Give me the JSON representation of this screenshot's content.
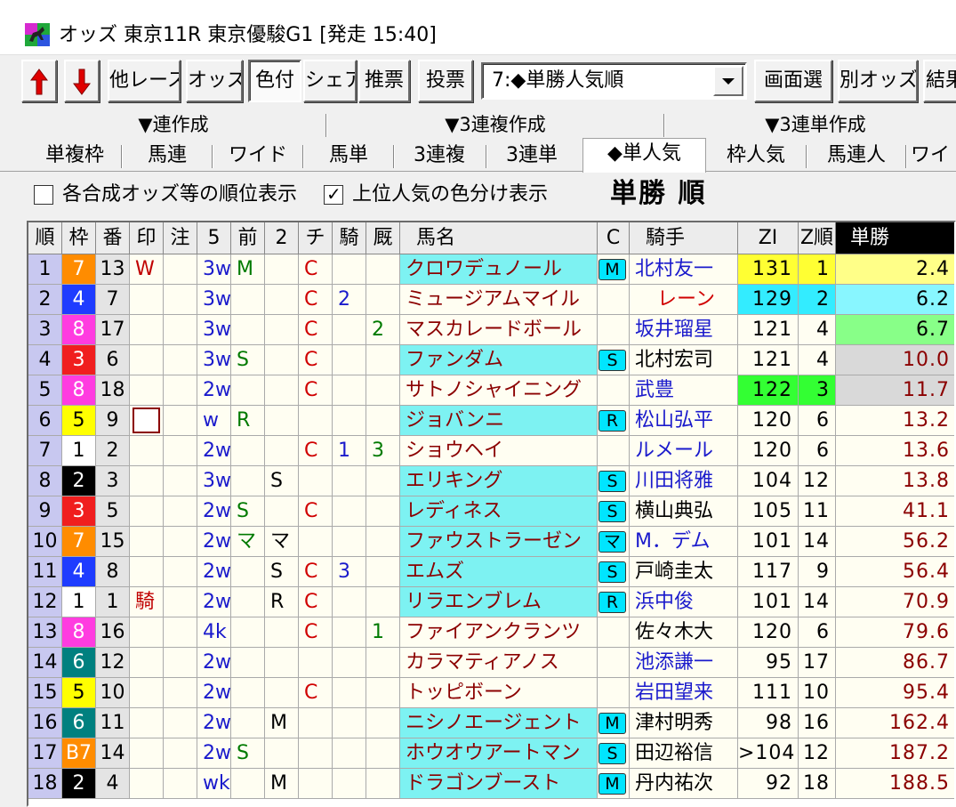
{
  "window": {
    "title": "オッズ 東京11R 東京優駿G1 [発走 15:40]",
    "icon": "race-horse-icon"
  },
  "toolbar": {
    "up_icon": "red-up-arrow-icon",
    "down_icon": "red-down-arrow-icon",
    "buttons": [
      "他レース",
      "オッズ",
      "色付",
      "シェア",
      "推票",
      "投票"
    ],
    "select_value": "7:◆単勝人気順",
    "right_buttons": [
      "画面選",
      "別オッズ",
      "結果"
    ]
  },
  "group_tabs": [
    "▼連作成",
    "▼3連複作成",
    "▼3連単作成"
  ],
  "tabs": [
    "単複枠",
    "馬連",
    "ワイド",
    "馬単",
    "3連複",
    "3連単",
    "◆単人気",
    "枠人気",
    "馬連人",
    "ワイ"
  ],
  "options": {
    "rank_label": "各合成オッズ等の順位表示",
    "rank_checked": false,
    "color_label": "上位人気の色分け表示",
    "color_checked": true,
    "check_mark": "✓",
    "view_title": "単勝 順"
  },
  "columns": [
    "順",
    "枠",
    "番",
    "印",
    "注",
    "5",
    "前",
    "2",
    "チ",
    "騎",
    "厩",
    "馬名",
    "C",
    "騎手",
    "ZI",
    "Z順",
    "単勝"
  ],
  "colors": {
    "waku": {
      "1": "#ffffff",
      "2": "#000000",
      "3": "#f01e1e",
      "4": "#1e3cff",
      "5": "#ffff00",
      "6": "#00807f",
      "7": "#ff8c00",
      "8": "#ff3ce0"
    },
    "name_highlight": "#7df2f2",
    "rank1": "#ffff33",
    "rank2": "#33ecff",
    "rank3": "#33ff33",
    "odds_rank1": "#ffff88",
    "odds_rank2": "#88f6ff",
    "odds_rank3": "#88ff88",
    "odds_grey": "#d9d9d9"
  },
  "rows": [
    {
      "rank": "1",
      "waku": "7",
      "ban": "13",
      "shirushi": "W",
      "chu": "",
      "five": "3w",
      "mae": "M",
      "two": "",
      "chi": "C",
      "ki": "",
      "kyu": "",
      "name": "クロワデュノール",
      "hl": true,
      "c": "M",
      "jockey": "北村友一",
      "jblue": true,
      "zi": "131",
      "zr": "1",
      "odds": "2.4",
      "zc": "rank1",
      "oc": "odds_rank1"
    },
    {
      "rank": "2",
      "waku": "4",
      "ban": "7",
      "shirushi": "",
      "chu": "",
      "five": "3w",
      "mae": "",
      "two": "",
      "chi": "C",
      "ki": "2",
      "kyu": "",
      "name": "ミュージアムマイル",
      "hl": false,
      "c": "",
      "jockey": "レーン",
      "jblue": false,
      "zi": "129",
      "zr": "2",
      "odds": "6.2",
      "zc": "rank2",
      "oc": "odds_rank2"
    },
    {
      "rank": "3",
      "waku": "8",
      "ban": "17",
      "shirushi": "",
      "chu": "",
      "five": "3w",
      "mae": "",
      "two": "",
      "chi": "C",
      "ki": "",
      "kyu": "2",
      "name": "マスカレードボール",
      "hl": false,
      "c": "",
      "jockey": "坂井瑠星",
      "jblue": true,
      "zi": "121",
      "zr": "4",
      "odds": "6.7",
      "zc": "",
      "oc": "odds_rank3"
    },
    {
      "rank": "4",
      "waku": "3",
      "ban": "6",
      "shirushi": "",
      "chu": "",
      "five": "3w",
      "mae": "S",
      "two": "",
      "chi": "C",
      "ki": "",
      "kyu": "",
      "name": "ファンダム",
      "hl": true,
      "c": "S",
      "jockey": "北村宏司",
      "jblue": false,
      "zi": "121",
      "zr": "4",
      "odds": "10.0",
      "zc": "",
      "oc": "odds_grey"
    },
    {
      "rank": "5",
      "waku": "8",
      "ban": "18",
      "shirushi": "",
      "chu": "",
      "five": "2w",
      "mae": "",
      "two": "",
      "chi": "C",
      "ki": "",
      "kyu": "",
      "name": "サトノシャイニング",
      "hl": false,
      "c": "",
      "jockey": "武豊",
      "jblue": true,
      "zi": "122",
      "zr": "3",
      "odds": "11.7",
      "zc": "rank3",
      "oc": "odds_grey"
    },
    {
      "rank": "6",
      "waku": "5",
      "ban": "9",
      "shirushi": "□",
      "chu": "",
      "five": "w",
      "mae": "R",
      "two": "",
      "chi": "",
      "ki": "",
      "kyu": "",
      "name": "ジョバンニ",
      "hl": true,
      "c": "R",
      "jockey": "松山弘平",
      "jblue": true,
      "zi": "120",
      "zr": "6",
      "odds": "13.2",
      "zc": "",
      "oc": ""
    },
    {
      "rank": "7",
      "waku": "1",
      "ban": "2",
      "shirushi": "",
      "chu": "",
      "five": "2w",
      "mae": "",
      "two": "",
      "chi": "C",
      "ki": "1",
      "kyu": "3",
      "name": "ショウヘイ",
      "hl": false,
      "c": "",
      "jockey": "ルメール",
      "jblue": true,
      "zi": "120",
      "zr": "6",
      "odds": "13.6",
      "zc": "",
      "oc": ""
    },
    {
      "rank": "8",
      "waku": "2",
      "ban": "3",
      "shirushi": "",
      "chu": "",
      "five": "3w",
      "mae": "",
      "two": "S",
      "chi": "",
      "ki": "",
      "kyu": "",
      "name": "エリキング",
      "hl": true,
      "c": "S",
      "jockey": "川田将雅",
      "jblue": true,
      "zi": "104",
      "zr": "12",
      "odds": "13.8",
      "zc": "",
      "oc": ""
    },
    {
      "rank": "9",
      "waku": "3",
      "ban": "5",
      "shirushi": "",
      "chu": "",
      "five": "2w",
      "mae": "S",
      "two": "",
      "chi": "C",
      "ki": "",
      "kyu": "",
      "name": "レディネス",
      "hl": true,
      "c": "S",
      "jockey": "横山典弘",
      "jblue": false,
      "zi": "105",
      "zr": "11",
      "odds": "41.1",
      "zc": "",
      "oc": ""
    },
    {
      "rank": "10",
      "waku": "7",
      "ban": "15",
      "shirushi": "",
      "chu": "",
      "five": "2w",
      "mae": "マ",
      "two": "マ",
      "chi": "",
      "ki": "",
      "kyu": "",
      "name": "ファウストラーゼン",
      "hl": true,
      "c": "マ",
      "jockey": "M．デム",
      "jblue": true,
      "zi": "101",
      "zr": "14",
      "odds": "56.2",
      "zc": "",
      "oc": ""
    },
    {
      "rank": "11",
      "waku": "4",
      "ban": "8",
      "shirushi": "",
      "chu": "",
      "five": "2w",
      "mae": "",
      "two": "S",
      "chi": "C",
      "ki": "3",
      "kyu": "",
      "name": "エムズ",
      "hl": true,
      "c": "S",
      "jockey": "戸崎圭太",
      "jblue": false,
      "zi": "117",
      "zr": "9",
      "odds": "56.4",
      "zc": "",
      "oc": ""
    },
    {
      "rank": "12",
      "waku": "1",
      "ban": "1",
      "shirushi": "騎",
      "chu": "",
      "five": "2w",
      "mae": "",
      "two": "R",
      "chi": "C",
      "ki": "",
      "kyu": "",
      "name": "リラエンブレム",
      "hl": true,
      "c": "R",
      "jockey": "浜中俊",
      "jblue": true,
      "zi": "101",
      "zr": "14",
      "odds": "70.9",
      "zc": "",
      "oc": ""
    },
    {
      "rank": "13",
      "waku": "8",
      "ban": "16",
      "shirushi": "",
      "chu": "",
      "five": "4k",
      "mae": "",
      "two": "",
      "chi": "C",
      "ki": "",
      "kyu": "1",
      "name": "ファイアンクランツ",
      "hl": false,
      "c": "",
      "jockey": "佐々木大",
      "jblue": false,
      "zi": "120",
      "zr": "6",
      "odds": "79.6",
      "zc": "",
      "oc": ""
    },
    {
      "rank": "14",
      "waku": "6",
      "ban": "12",
      "shirushi": "",
      "chu": "",
      "five": "2w",
      "mae": "",
      "two": "",
      "chi": "",
      "ki": "",
      "kyu": "",
      "name": "カラマティアノス",
      "hl": false,
      "c": "",
      "jockey": "池添謙一",
      "jblue": true,
      "zi": "95",
      "zr": "17",
      "odds": "86.7",
      "zc": "",
      "oc": ""
    },
    {
      "rank": "15",
      "waku": "5",
      "ban": "10",
      "shirushi": "",
      "chu": "",
      "five": "2w",
      "mae": "",
      "two": "",
      "chi": "C",
      "ki": "",
      "kyu": "",
      "name": "トッピボーン",
      "hl": false,
      "c": "",
      "jockey": "岩田望来",
      "jblue": true,
      "zi": "111",
      "zr": "10",
      "odds": "95.4",
      "zc": "",
      "oc": ""
    },
    {
      "rank": "16",
      "waku": "6",
      "ban": "11",
      "shirushi": "",
      "chu": "",
      "five": "2w",
      "mae": "",
      "two": "M",
      "chi": "",
      "ki": "",
      "kyu": "",
      "name": "ニシノエージェント",
      "hl": true,
      "c": "M",
      "jockey": "津村明秀",
      "jblue": false,
      "zi": "98",
      "zr": "16",
      "odds": "162.4",
      "zc": "",
      "oc": ""
    },
    {
      "rank": "17",
      "waku": "B7",
      "ban": "14",
      "shirushi": "",
      "chu": "",
      "five": "2w",
      "mae": "S",
      "two": "",
      "chi": "",
      "ki": "",
      "kyu": "",
      "name": "ホウオウアートマン",
      "hl": true,
      "c": "S",
      "jockey": "田辺裕信",
      "jblue": false,
      "zi": ">104",
      "zr": "12",
      "odds": "187.2",
      "zc": "",
      "oc": ""
    },
    {
      "rank": "18",
      "waku": "2",
      "ban": "4",
      "shirushi": "",
      "chu": "",
      "five": "wk",
      "mae": "",
      "two": "M",
      "chi": "",
      "ki": "",
      "kyu": "",
      "name": "ドラゴンブースト",
      "hl": true,
      "c": "M",
      "jockey": "丹内祐次",
      "jblue": false,
      "zi": "92",
      "zr": "18",
      "odds": "188.5",
      "zc": "",
      "oc": ""
    }
  ]
}
